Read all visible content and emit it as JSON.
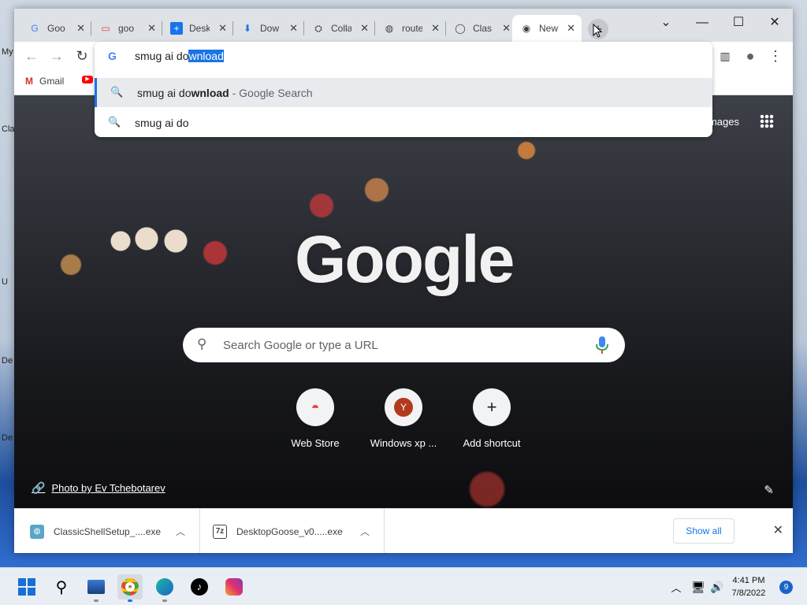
{
  "desktop": {
    "labels": [
      "My",
      "Cla",
      "U",
      "De",
      "De"
    ]
  },
  "tabs": [
    {
      "title": "Goo",
      "icon": "google-docs-icon"
    },
    {
      "title": "goo",
      "icon": "gmail-style-icon"
    },
    {
      "title": "Desk",
      "icon": "desk-plus-icon"
    },
    {
      "title": "Dow",
      "icon": "download-icon"
    },
    {
      "title": "Colla",
      "icon": "colab-icon"
    },
    {
      "title": "route",
      "icon": "globe-icon"
    },
    {
      "title": "Clas",
      "icon": "ring-icon"
    },
    {
      "title": "New",
      "icon": "chrome-icon",
      "active": true
    }
  ],
  "omnibox": {
    "typed": "smug ai do",
    "autocomplete": "wnload",
    "suggestions": [
      {
        "pre": "smug ai do",
        "bold": "wnload",
        "suffix": " - Google Search"
      },
      {
        "pre": "smug ai do",
        "bold": "",
        "suffix": ""
      }
    ]
  },
  "bookmarks": {
    "gmail": "Gmail"
  },
  "ntp": {
    "images_link": "Images",
    "logo": "Google",
    "search_placeholder": "Search Google or type a URL",
    "shortcuts": [
      {
        "label": "Web Store",
        "icon": "webstore-icon"
      },
      {
        "label": "Windows xp ...",
        "icon": "Y"
      },
      {
        "label": "Add shortcut",
        "icon": "plus-icon"
      }
    ],
    "photo_credit": "Photo by Ev Tchebotarev"
  },
  "downloads": {
    "items": [
      "ClassicShellSetup_....exe",
      "DesktopGoose_v0.....exe"
    ],
    "show_all": "Show all"
  },
  "taskbar": {
    "time": "4:41 PM",
    "date": "7/8/2022",
    "notifications": "9"
  }
}
